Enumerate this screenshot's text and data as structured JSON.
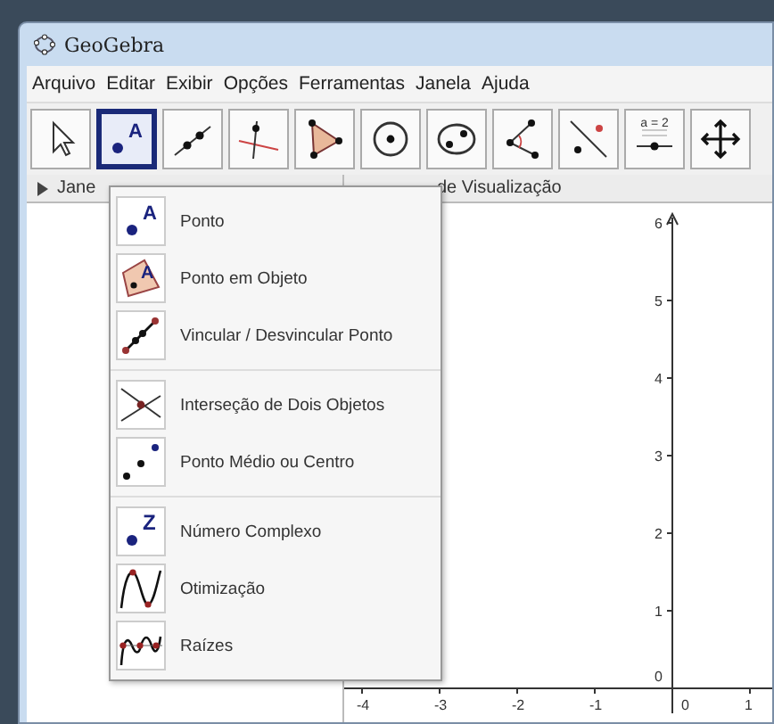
{
  "window": {
    "title": "GeoGebra"
  },
  "menu": [
    "Arquivo",
    "Editar",
    "Exibir",
    "Opções",
    "Ferramentas",
    "Janela",
    "Ajuda"
  ],
  "tools": [
    {
      "kind": "move",
      "selected": false
    },
    {
      "kind": "point",
      "letter": "A",
      "selected": true
    },
    {
      "kind": "line",
      "selected": false
    },
    {
      "kind": "perpendicular",
      "selected": false
    },
    {
      "kind": "polygon",
      "selected": false
    },
    {
      "kind": "circle",
      "selected": false
    },
    {
      "kind": "conic",
      "selected": false
    },
    {
      "kind": "angle",
      "selected": false
    },
    {
      "kind": "reflect",
      "selected": false
    },
    {
      "kind": "slider",
      "label": "a = 2",
      "selected": false
    },
    {
      "kind": "move-view",
      "selected": false
    }
  ],
  "algebra_header": "Jane",
  "graphics": {
    "header": "de Visualização",
    "x_ticks": [
      "-4",
      "-3",
      "-2",
      "-1",
      "0",
      "1"
    ],
    "y_ticks": [
      "6",
      "5",
      "4",
      "3",
      "2",
      "1",
      "0"
    ]
  },
  "tool_menu": [
    [
      {
        "kind": "point",
        "letter": "A",
        "label": "Ponto"
      },
      {
        "kind": "point-on-object",
        "letter": "A",
        "label": "Ponto em Objeto"
      },
      {
        "kind": "attach",
        "label": "Vincular / Desvincular Ponto"
      }
    ],
    [
      {
        "kind": "intersect",
        "label": "Interseção de Dois Objetos"
      },
      {
        "kind": "midpoint",
        "label": "Ponto Médio ou Centro"
      }
    ],
    [
      {
        "kind": "complex",
        "letter": "Z",
        "label": "Número Complexo"
      },
      {
        "kind": "extremum",
        "label": "Otimização"
      },
      {
        "kind": "roots",
        "label": "Raízes"
      }
    ]
  ]
}
